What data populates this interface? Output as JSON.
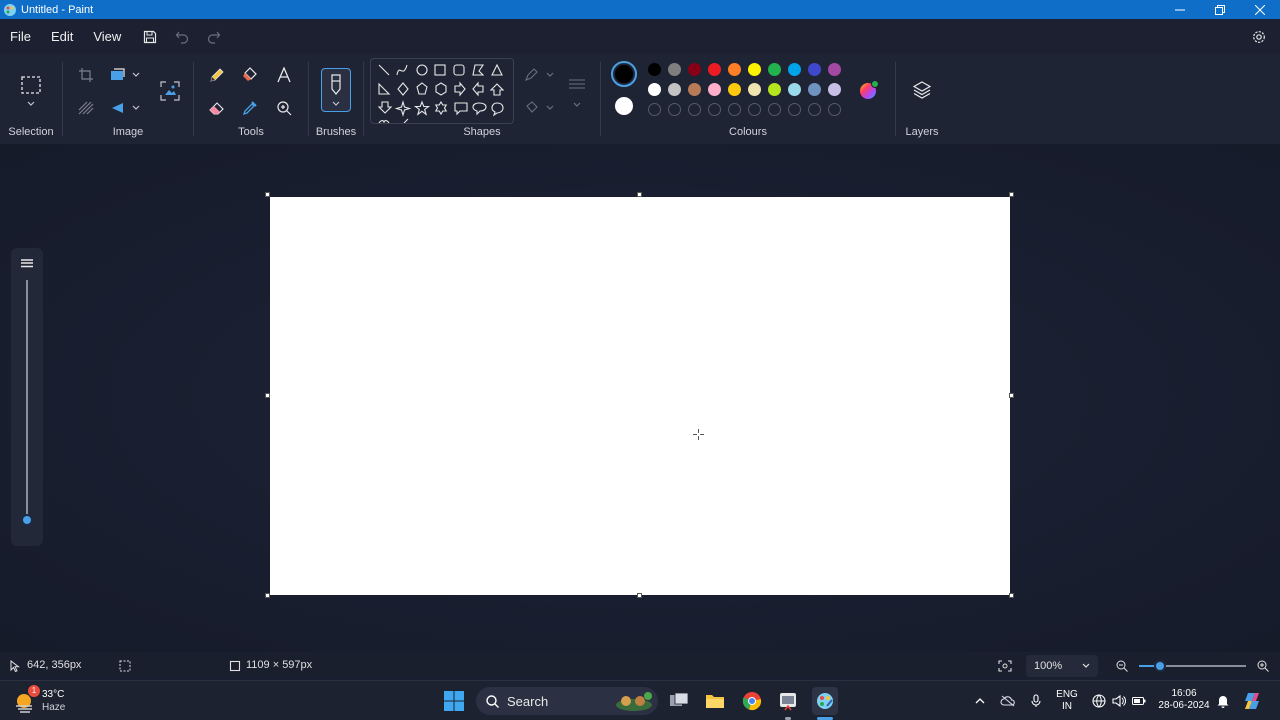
{
  "window": {
    "title": "Untitled - Paint"
  },
  "menu": {
    "file": "File",
    "edit": "Edit",
    "view": "View"
  },
  "ribbon": {
    "selection_label": "Selection",
    "image_label": "Image",
    "tools_label": "Tools",
    "brushes_label": "Brushes",
    "shapes_label": "Shapes",
    "colours_label": "Colours",
    "layers_label": "Layers"
  },
  "colours": {
    "primary": "#000000",
    "secondary": "#ffffff",
    "row1": [
      "#000000",
      "#7f7f7f",
      "#880015",
      "#ed1c24",
      "#ff7f27",
      "#fff200",
      "#22b14c",
      "#00a2e8",
      "#3f48cc",
      "#a349a4"
    ],
    "row2": [
      "#ffffff",
      "#c3c3c3",
      "#b97a57",
      "#ffaec9",
      "#ffc90e",
      "#efe4b0",
      "#b5e61d",
      "#99d9ea",
      "#7092be",
      "#c8bfe7"
    ]
  },
  "status": {
    "cursor_position": "642, 356px",
    "canvas_size": "1109 × 597px",
    "zoom": "100%",
    "zoom_slider_fraction": 0.2
  },
  "brush_size_fraction": 0.0,
  "taskbar": {
    "weather_temp": "33°C",
    "weather_desc": "Haze",
    "weather_badge": "1",
    "search_label": "Search",
    "lang_line1": "ENG",
    "lang_line2": "IN",
    "time": "16:06",
    "date": "28-06-2024"
  }
}
